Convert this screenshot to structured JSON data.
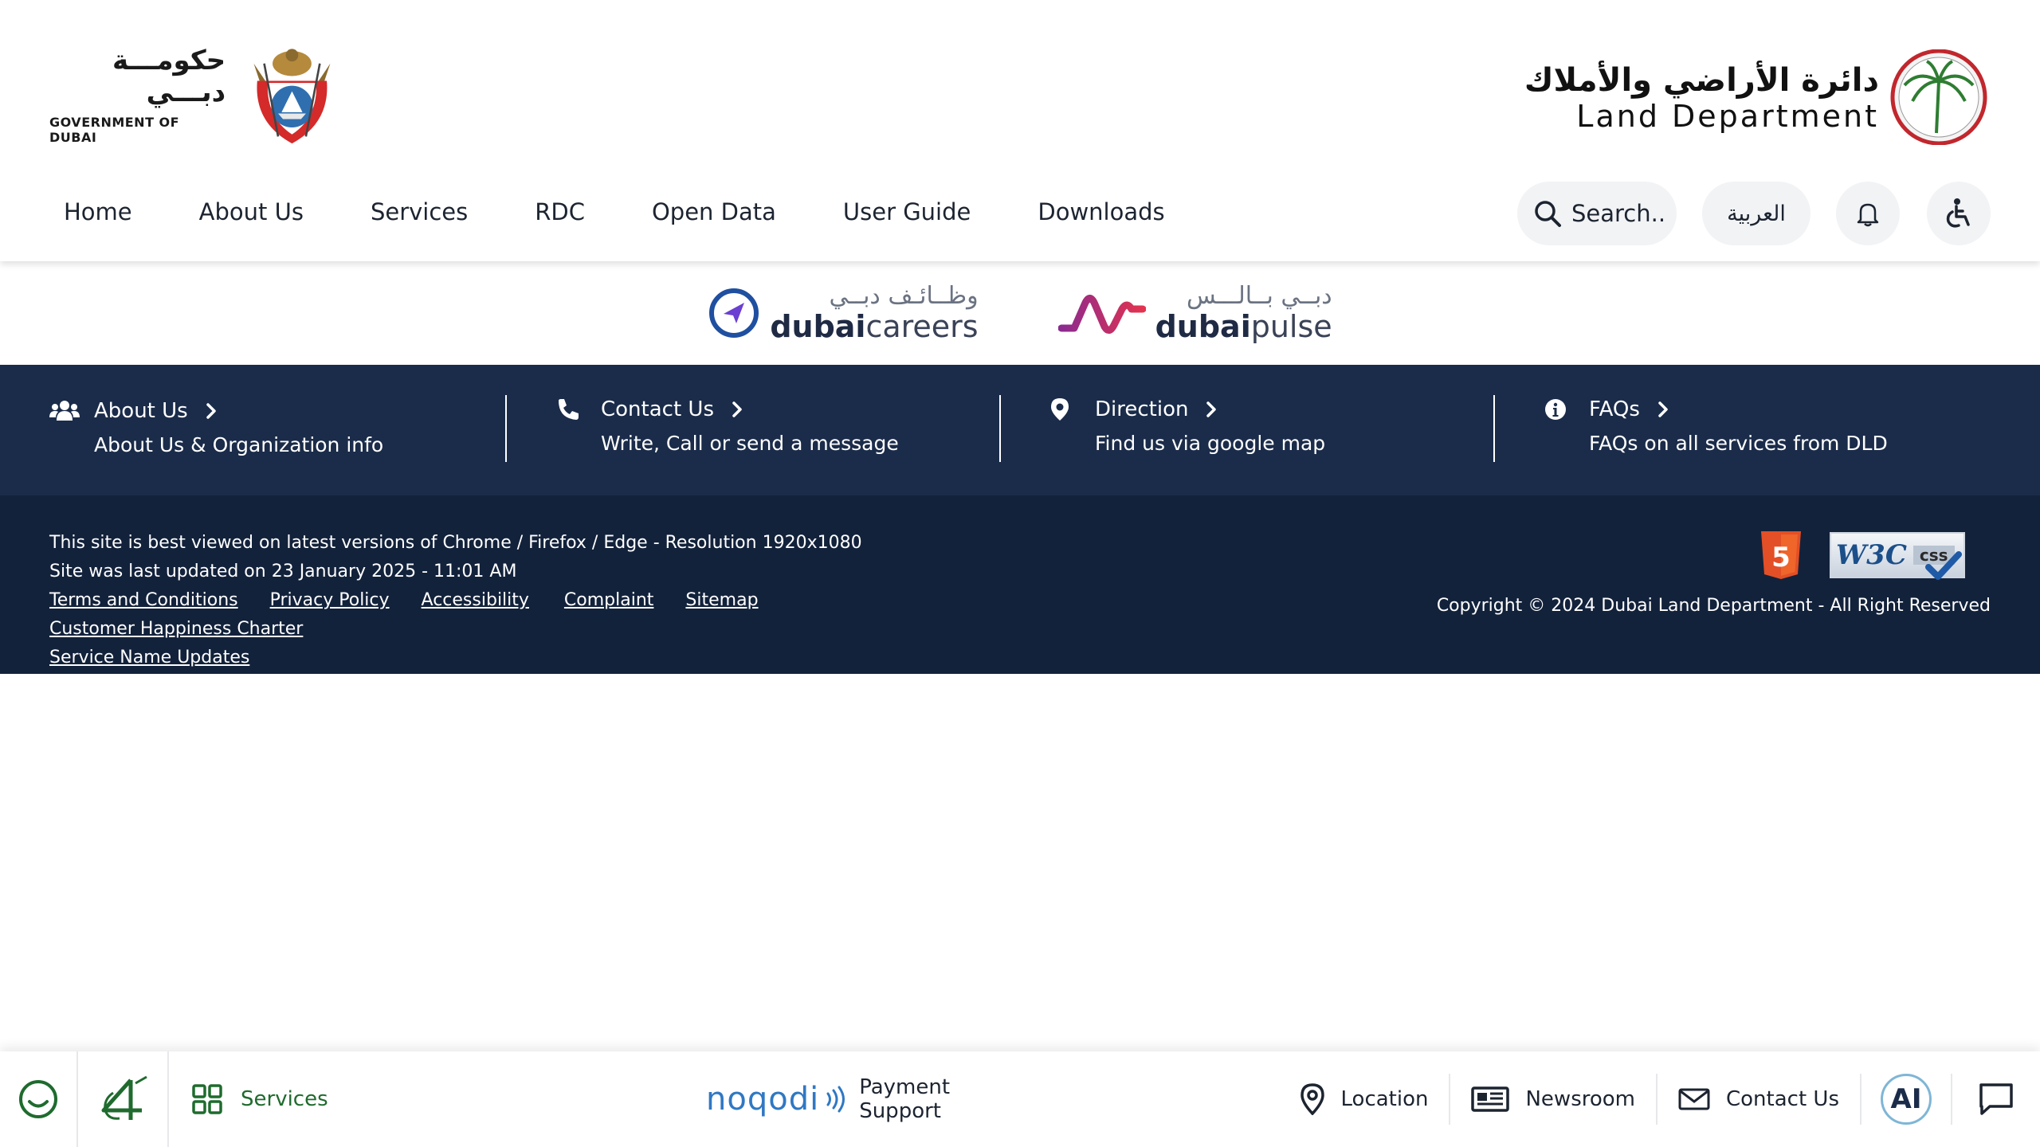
{
  "header": {
    "gov_logo": {
      "arabic": "حكومـــة دبـــي",
      "english": "GOVERNMENT OF DUBAI"
    },
    "dld_logo": {
      "arabic": "دائرة الأراضي والأملاك",
      "english": "Land Department"
    },
    "nav": [
      "Home",
      "About Us",
      "Services",
      "RDC",
      "Open Data",
      "User Guide",
      "Downloads"
    ],
    "search_label": "Search..",
    "language_label": "العربية",
    "icons": {
      "search": "search-icon",
      "notifications": "bell-icon",
      "accessibility": "wheelchair-icon"
    }
  },
  "partners": [
    {
      "arabic": "وظــائـف دبــي",
      "brand_bold": "dubai",
      "brand_rest": "careers",
      "icon": "paper-plane-icon"
    },
    {
      "arabic": "دبــي بــالـــس",
      "brand_bold": "dubai",
      "brand_rest": "pulse",
      "icon": "pulse-wave-icon"
    }
  ],
  "quicklinks": [
    {
      "title": "About Us",
      "subtitle": "About Us & Organization info",
      "icon": "users-icon"
    },
    {
      "title": "Contact Us",
      "subtitle": "Write, Call or send a message",
      "icon": "phone-icon"
    },
    {
      "title": "Direction",
      "subtitle": "Find us via google map",
      "icon": "map-pin-icon"
    },
    {
      "title": "FAQs",
      "subtitle": "FAQs on all services from DLD",
      "icon": "info-icon"
    }
  ],
  "footer": {
    "best_viewed": "This site is best viewed on latest versions of Chrome / Firefox / Edge - Resolution 1920x1080",
    "last_updated": "Site was last updated on 23 January 2025 - 11:01 AM",
    "links": [
      "Terms and Conditions",
      "Privacy Policy",
      "Accessibility",
      "Complaint",
      "Sitemap",
      "Customer Happiness Charter",
      "Service Name Updates"
    ],
    "copyright": "Copyright © 2024 Dubai Land Department - All Right Reserved",
    "badges": {
      "html5": "5",
      "w3c": "W3C",
      "css": "css"
    }
  },
  "bottombar": {
    "services_label": "Services",
    "noqodi": "noqodi",
    "payment_support": [
      "Payment",
      "Support"
    ],
    "location_label": "Location",
    "newsroom_label": "Newsroom",
    "contact_label": "Contact Us",
    "ai_label": "AI"
  },
  "colors": {
    "navy_band": "#1b2c4a",
    "navy_footer": "#13223b",
    "green": "#1f6b2e",
    "noqodi_blue": "#2f78c4"
  }
}
